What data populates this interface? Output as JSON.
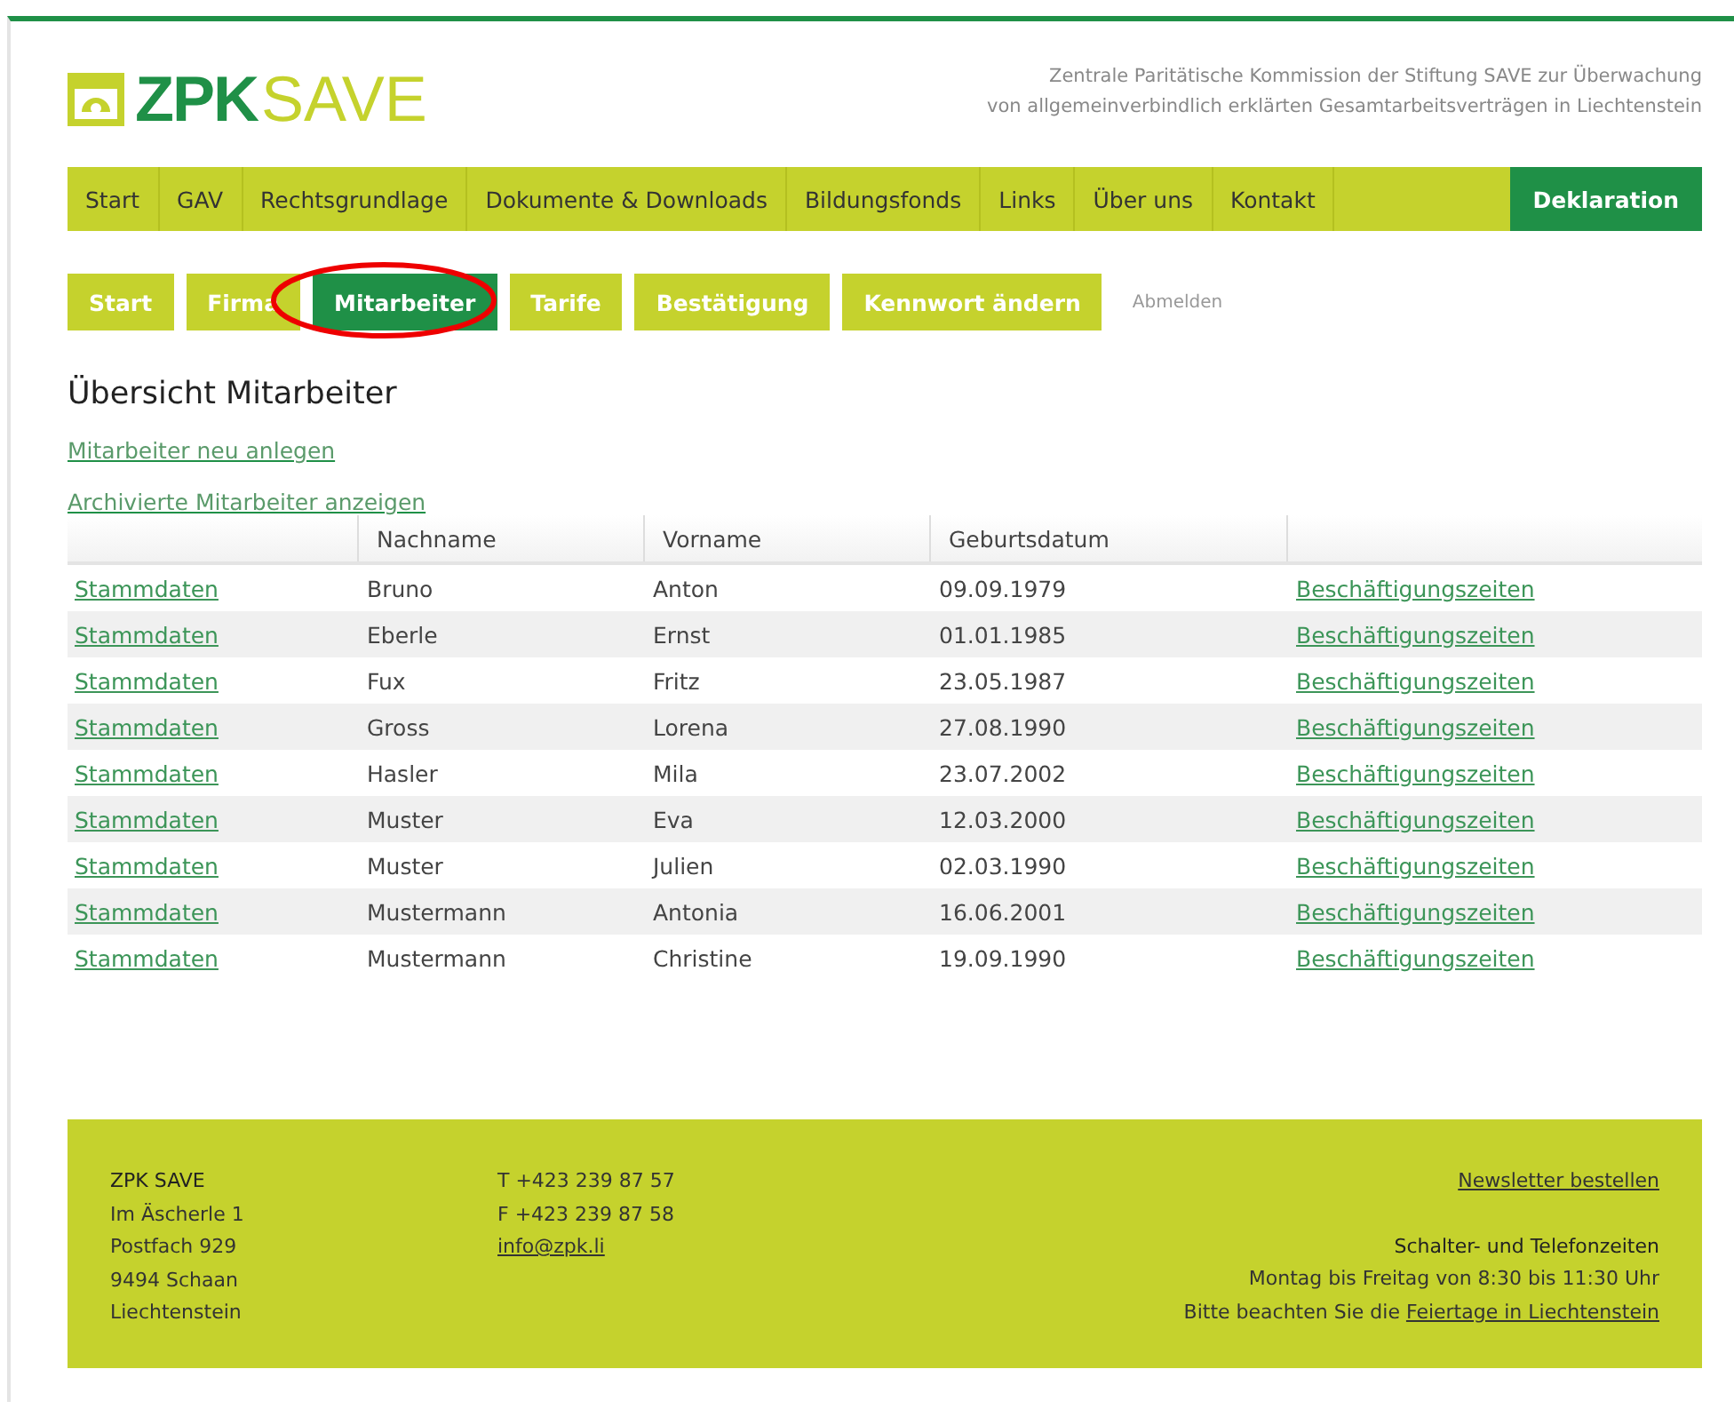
{
  "header": {
    "logo_bold": "ZPK",
    "logo_light": "SAVE",
    "tagline_lines": [
      "Zentrale Paritätische Kommission der Stiftung SAVE zur Überwachung",
      "von allgemeinverbindlich erklärten Gesamtarbeitsverträgen in Liechtenstein"
    ]
  },
  "main_nav": [
    {
      "label": "Start",
      "selected": false
    },
    {
      "label": "GAV",
      "selected": false
    },
    {
      "label": "Rechtsgrundlage",
      "selected": false
    },
    {
      "label": "Dokumente & Downloads",
      "selected": false
    },
    {
      "label": "Bildungsfonds",
      "selected": false
    },
    {
      "label": "Links",
      "selected": false
    },
    {
      "label": "Über uns",
      "selected": false
    },
    {
      "label": "Kontakt",
      "selected": false
    },
    {
      "label": "Deklaration",
      "selected": true
    }
  ],
  "sub_nav": [
    {
      "label": "Start",
      "selected": false
    },
    {
      "label": "Firma",
      "selected": false
    },
    {
      "label": "Mitarbeiter",
      "selected": true
    },
    {
      "label": "Tarife",
      "selected": false
    },
    {
      "label": "Bestätigung",
      "selected": false
    },
    {
      "label": "Kennwort ändern",
      "selected": false
    }
  ],
  "logout": "Abmelden",
  "title": "Übersicht Mitarbeiter",
  "actions": [
    "Mitarbeiter neu anlegen",
    "Archivierte Mitarbeiter anzeigen"
  ],
  "table": {
    "columns": [
      "Nachname",
      "Vorname",
      "Geburtsdatum"
    ],
    "rows": [
      {
        "link": "Stammdaten",
        "last": "Bruno",
        "first": "Anton",
        "born": "09.09.1979",
        "link2": "Beschäftigungszeiten"
      },
      {
        "link": "Stammdaten",
        "last": "Eberle",
        "first": "Ernst",
        "born": "01.01.1985",
        "link2": "Beschäftigungszeiten"
      },
      {
        "link": "Stammdaten",
        "last": "Fux",
        "first": "Fritz",
        "born": "23.05.1987",
        "link2": "Beschäftigungszeiten"
      },
      {
        "link": "Stammdaten",
        "last": "Gross",
        "first": "Lorena",
        "born": "27.08.1990",
        "link2": "Beschäftigungszeiten"
      },
      {
        "link": "Stammdaten",
        "last": "Hasler",
        "first": "Mila",
        "born": "23.07.2002",
        "link2": "Beschäftigungszeiten"
      },
      {
        "link": "Stammdaten",
        "last": "Muster",
        "first": "Eva",
        "born": "12.03.2000",
        "link2": "Beschäftigungszeiten"
      },
      {
        "link": "Stammdaten",
        "last": "Muster",
        "first": "Julien",
        "born": "02.03.1990",
        "link2": "Beschäftigungszeiten"
      },
      {
        "link": "Stammdaten",
        "last": "Mustermann",
        "first": "Antonia",
        "born": "16.06.2001",
        "link2": "Beschäftigungszeiten"
      },
      {
        "link": "Stammdaten",
        "last": "Mustermann",
        "first": "Christine",
        "born": "19.09.1990",
        "link2": "Beschäftigungszeiten"
      }
    ]
  },
  "footer": {
    "org": "ZPK SAVE",
    "address": [
      "Im Äscherle 1",
      "Postfach 929",
      "9494 Schaan",
      "Liechtenstein"
    ],
    "phone": "T +423 239 87 57",
    "fax": "F +423 239 87 58",
    "email": "info@zpk.li",
    "newsletter": "Newsletter bestellen",
    "hours_title": "Schalter- und Telefonzeiten",
    "hours": "Montag bis Freitag von 8:30 bis 11:30 Uhr",
    "holiday_text": "Bitte beachten Sie die",
    "holiday_link": "Feiertage in Liechtenstein"
  }
}
